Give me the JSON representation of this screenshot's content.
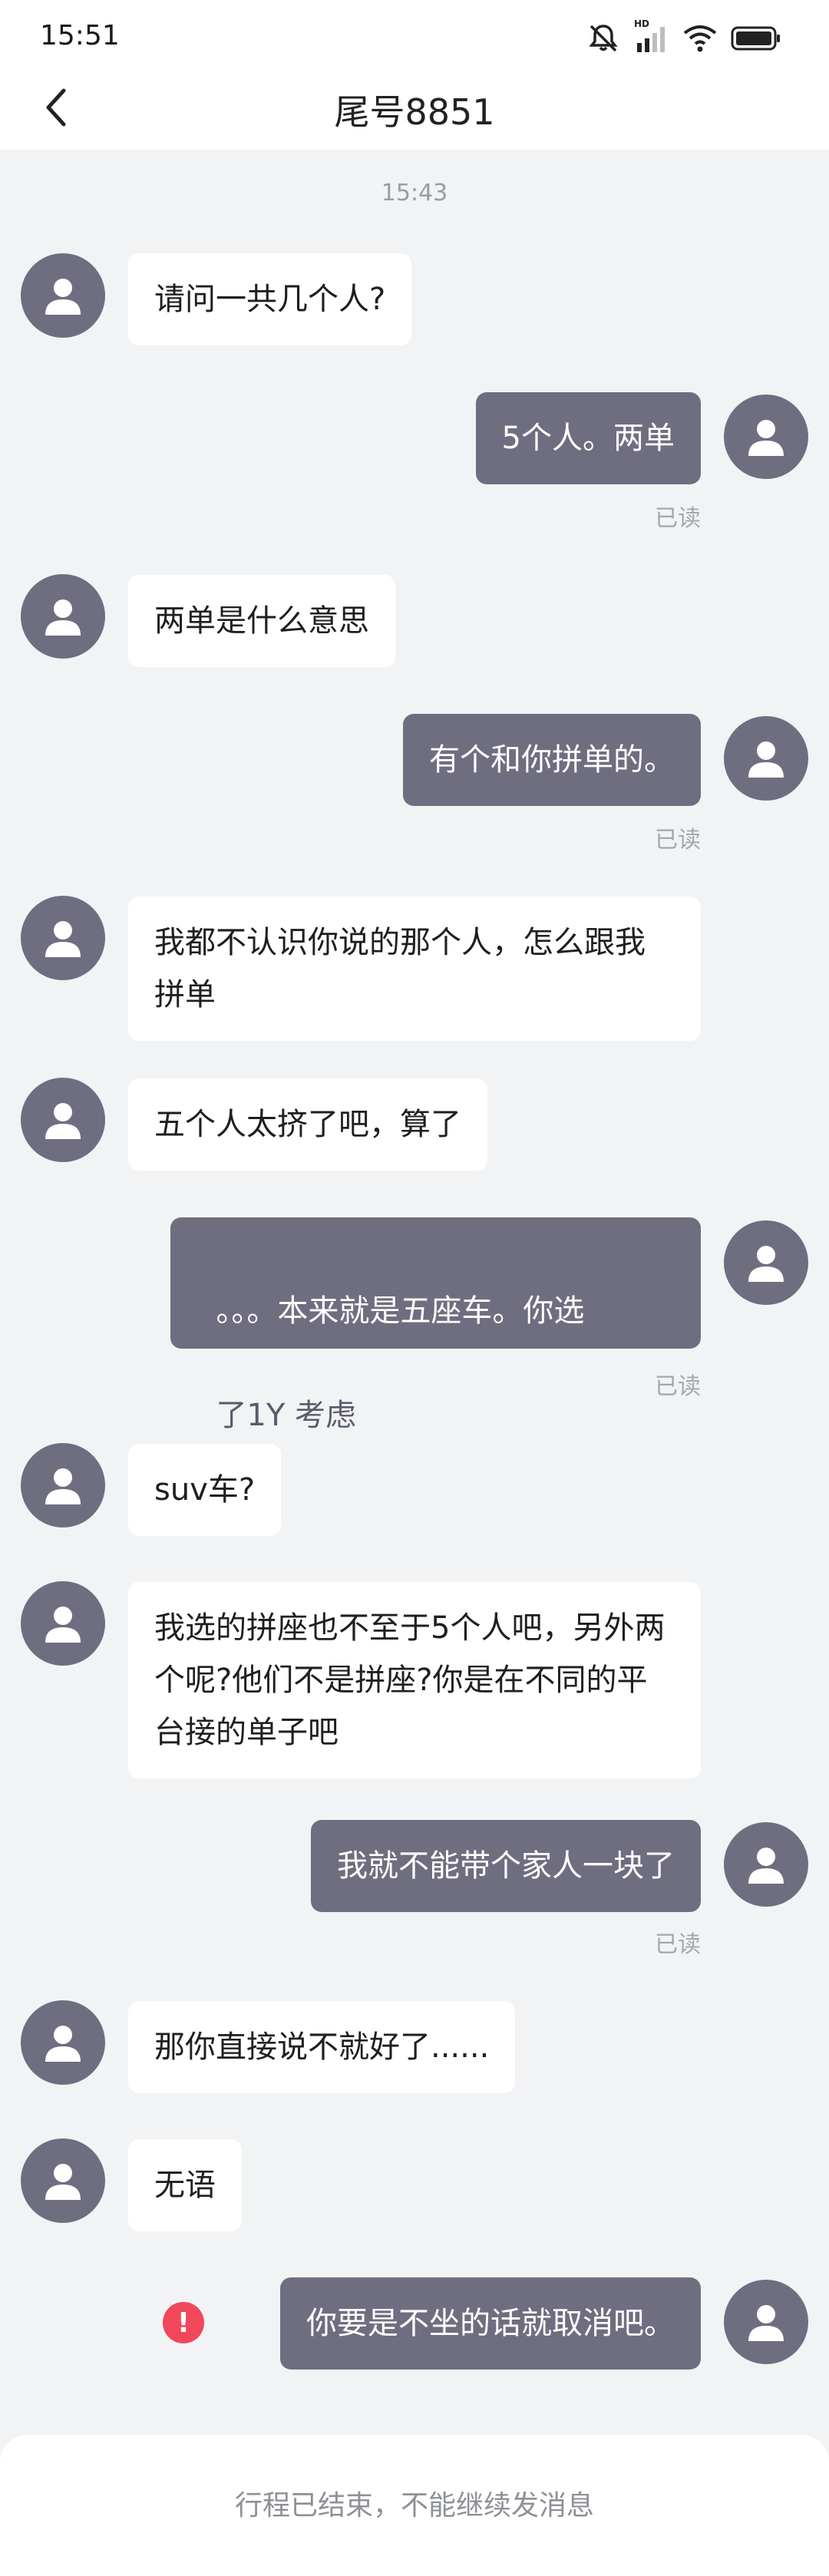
{
  "status_bar": {
    "time": "15:51",
    "icons": [
      "mute-icon",
      "signal-hd-icon",
      "wifi-icon",
      "battery-icon"
    ],
    "hd_label": "HD"
  },
  "nav": {
    "title": "尾号8851",
    "back_icon": "chevron-left-icon"
  },
  "conversation": {
    "timestamp": "15:43",
    "read_label": "已读",
    "messages": [
      {
        "from": "other",
        "text": "请问一共几个人?"
      },
      {
        "from": "me",
        "text": "5个人。两单",
        "status": "已读"
      },
      {
        "from": "other",
        "text": "两单是什么意思"
      },
      {
        "from": "me",
        "text": "有个和你拼单的。",
        "status": "已读"
      },
      {
        "from": "other",
        "text": "我都不认识你说的那个人，怎么跟我拼单"
      },
      {
        "from": "other",
        "text": "五个人太挤了吧，算了"
      },
      {
        "from": "me",
        "text": "。。。本来就是五座车。你选",
        "text_faded": "了1Y 考虑",
        "status": "已读"
      },
      {
        "from": "other",
        "text": "suv车?"
      },
      {
        "from": "other",
        "text": "我选的拼座也不至于5个人吧，另外两个呢?他们不是拼座?你是在不同的平台接的单子吧"
      },
      {
        "from": "me",
        "text": "我就不能带个家人一块了",
        "status": "已读"
      },
      {
        "from": "other",
        "text": "那你直接说不就好了......"
      },
      {
        "from": "other",
        "text": "无语"
      },
      {
        "from": "me",
        "text": "你要是不坐的话就取消吧。",
        "status": "failed"
      }
    ]
  },
  "footer": {
    "text": "行程已结束，不能继续发消息"
  },
  "colors": {
    "background": "#f2f3f5",
    "bubble_out": "#6f6e80",
    "bubble_in": "#ffffff",
    "avatar": "#6f6e80",
    "error": "#f0475a"
  }
}
